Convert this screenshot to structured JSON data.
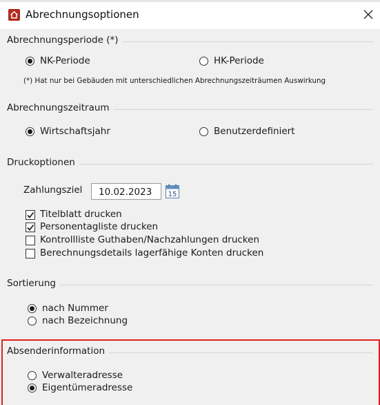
{
  "window": {
    "title": "Abrechnungsoptionen",
    "close_glyph": "✕",
    "icon": "house-icon"
  },
  "abrechnungsperiode": {
    "title": "Abrechnungsperiode (*)",
    "options": [
      "NK-Periode",
      "HK-Periode"
    ],
    "selected": "NK-Periode",
    "note": "(*) Hat nur bei Gebäuden mit unterschiedlichen Abrechnungszeiträumen Auswirkung"
  },
  "abrechnungszeitraum": {
    "title": "Abrechnungszeitraum",
    "options": [
      "Wirtschaftsjahr",
      "Benutzerdefiniert"
    ],
    "selected": "Wirtschaftsjahr"
  },
  "druckoptionen": {
    "title": "Druckoptionen",
    "zahlungsziel_label": "Zahlungsziel",
    "zahlungsziel_value": "10.02.2023",
    "calendar_day": "15",
    "checkboxes": [
      {
        "label": "Titelblatt drucken",
        "checked": true
      },
      {
        "label": "Personentagliste drucken",
        "checked": true
      },
      {
        "label": "Kontrollliste Guthaben/Nachzahlungen drucken",
        "checked": false
      },
      {
        "label": "Berechnungsdetails lagerfähige Konten drucken",
        "checked": false
      }
    ]
  },
  "sortierung": {
    "title": "Sortierung",
    "options": [
      "nach Nummer",
      "nach Bezeichnung"
    ],
    "selected": "nach Nummer"
  },
  "absenderinformation": {
    "title": "Absenderinformation",
    "options": [
      "Verwalteradresse",
      "Eigentümeradresse"
    ],
    "selected": "Eigentümeradresse",
    "highlight_color": "#e0211b"
  }
}
